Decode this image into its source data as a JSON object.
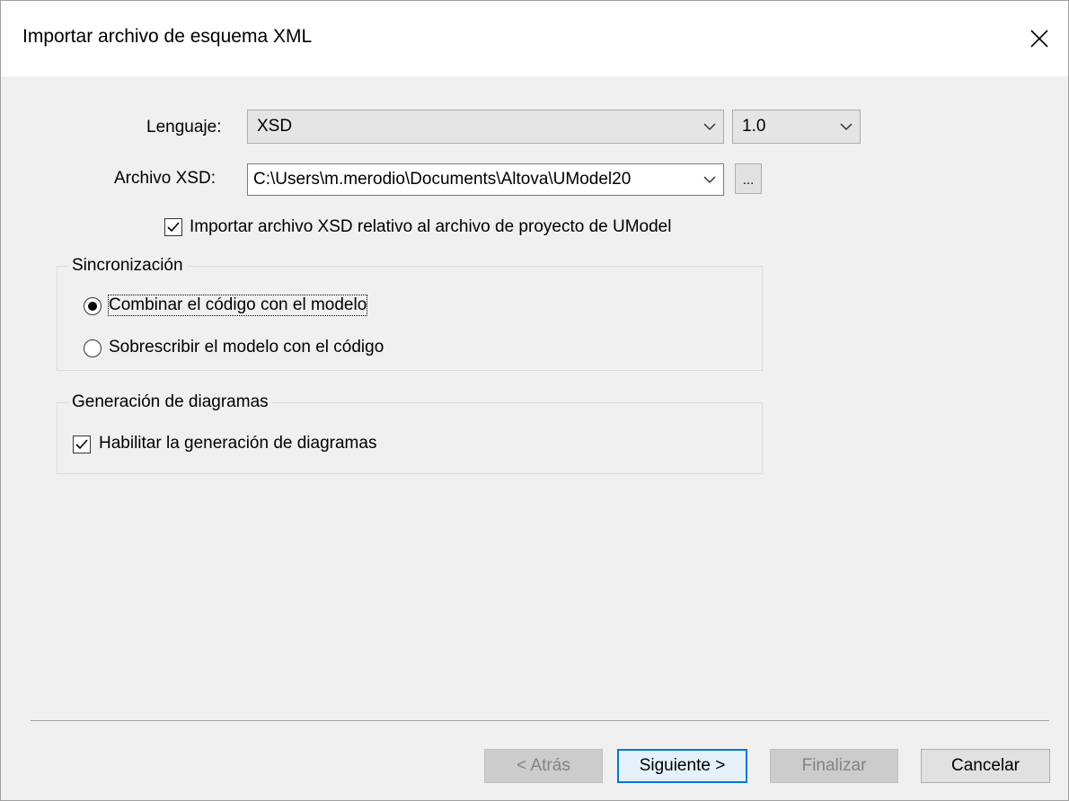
{
  "dialog": {
    "title": "Importar archivo de esquema XML"
  },
  "language": {
    "label": "Lenguaje:",
    "value": "XSD",
    "version": "1.0"
  },
  "xsd_file": {
    "label": "Archivo XSD:",
    "value": "C:\\Users\\m.merodio\\Documents\\Altova\\UModel20",
    "browse_label": "..."
  },
  "relative_import": {
    "label": "Importar archivo XSD relativo al archivo de proyecto de UModel",
    "checked": true
  },
  "sync": {
    "title": "Sincronización",
    "options": [
      {
        "label": "Combinar el código con el modelo",
        "selected": true
      },
      {
        "label": "Sobrescribir el modelo con el código",
        "selected": false
      }
    ]
  },
  "diagram": {
    "title": "Generación de diagramas",
    "enable_label": "Habilitar la generación de diagramas",
    "checked": true
  },
  "buttons": {
    "back": "< Atrás",
    "next": "Siguiente >",
    "finish": "Finalizar",
    "cancel": "Cancelar"
  },
  "colors": {
    "accent": "#0078d7",
    "dialog_bg": "#f0f0f0"
  }
}
